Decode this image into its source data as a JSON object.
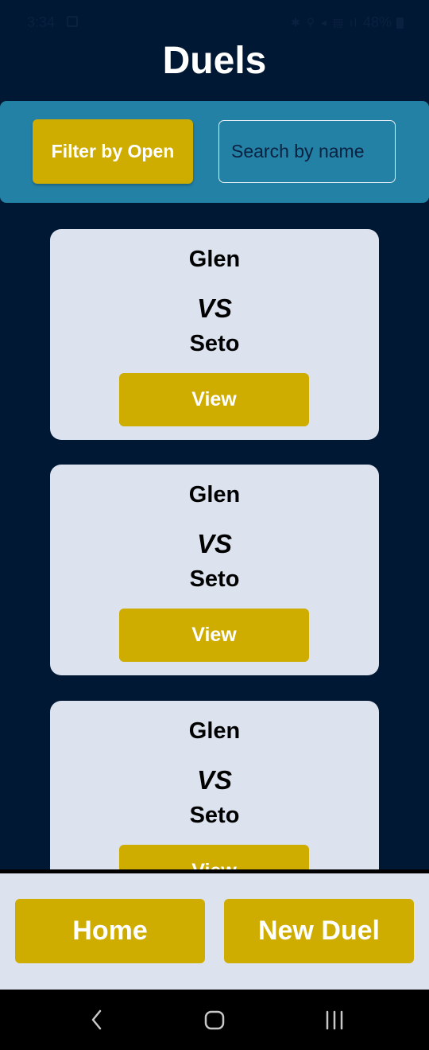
{
  "status_bar": {
    "time": "3:34",
    "indicators": "✱ ⚲ ◂ ▤ ıl",
    "battery": "48%",
    "icons": [
      "image-icon",
      "battery-icon"
    ]
  },
  "header": {
    "title": "Duels"
  },
  "filter_bar": {
    "filter_label": "Filter by Open",
    "search_placeholder": "Search by name",
    "search_value": ""
  },
  "duels": [
    {
      "player_one": "Glen",
      "vs": "VS",
      "player_two": "Seto",
      "view_label": "View"
    },
    {
      "player_one": "Glen",
      "vs": "VS",
      "player_two": "Seto",
      "view_label": "View"
    },
    {
      "player_one": "Glen",
      "vs": "VS",
      "player_two": "Seto",
      "view_label": "View"
    }
  ],
  "bottom_nav": {
    "home_label": "Home",
    "new_duel_label": "New Duel"
  },
  "system_nav": {
    "icons": [
      "back-icon",
      "home-circle-icon",
      "recents-icon"
    ]
  },
  "colors": {
    "background": "#001833",
    "filter_bar": "#2481a6",
    "accent_button": "#cfac00",
    "card": "#dce3ee"
  }
}
